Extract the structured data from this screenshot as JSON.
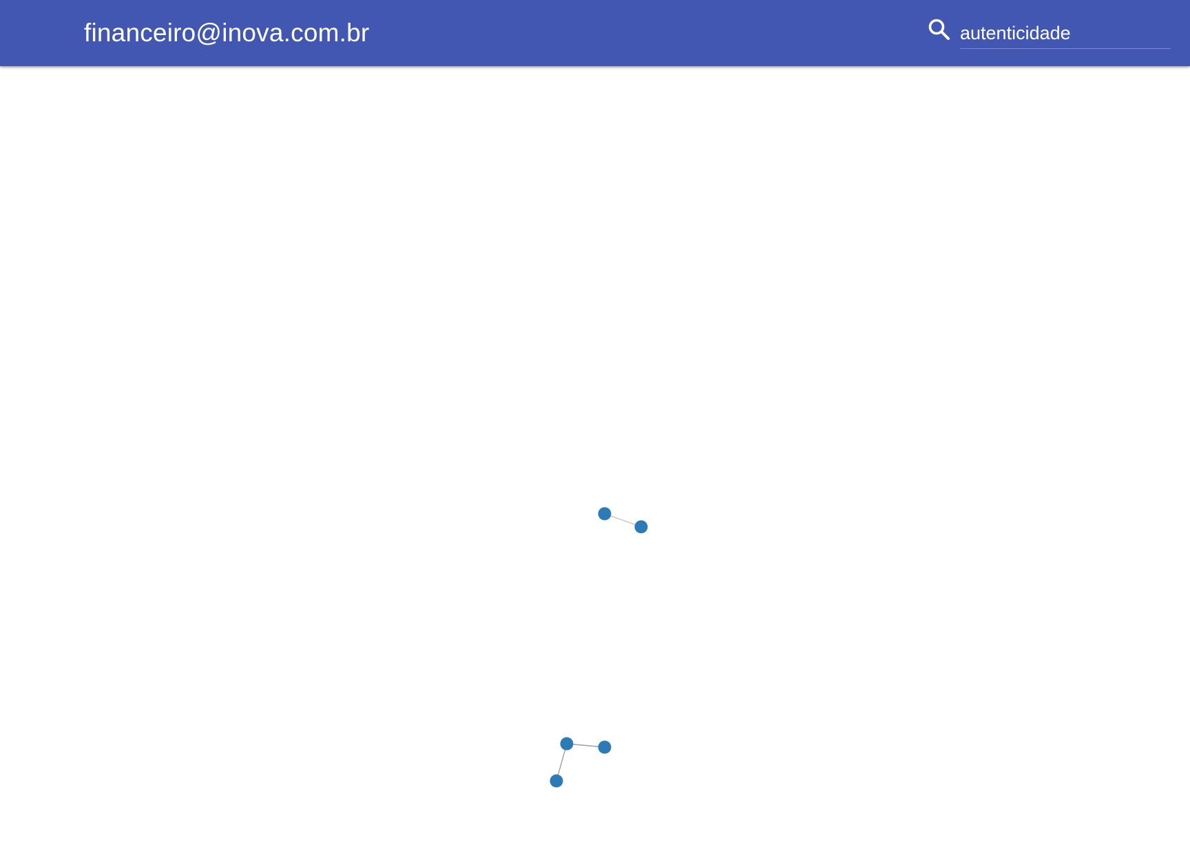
{
  "header": {
    "title": "financeiro@inova.com.br",
    "background_color": "#4257b2"
  },
  "search": {
    "icon": "search-icon",
    "value": "autenticidade"
  },
  "graph": {
    "node_color": "#2c7bb6",
    "edge_color": "#9e9e9e",
    "node_count": 5,
    "edge_count": 3
  }
}
